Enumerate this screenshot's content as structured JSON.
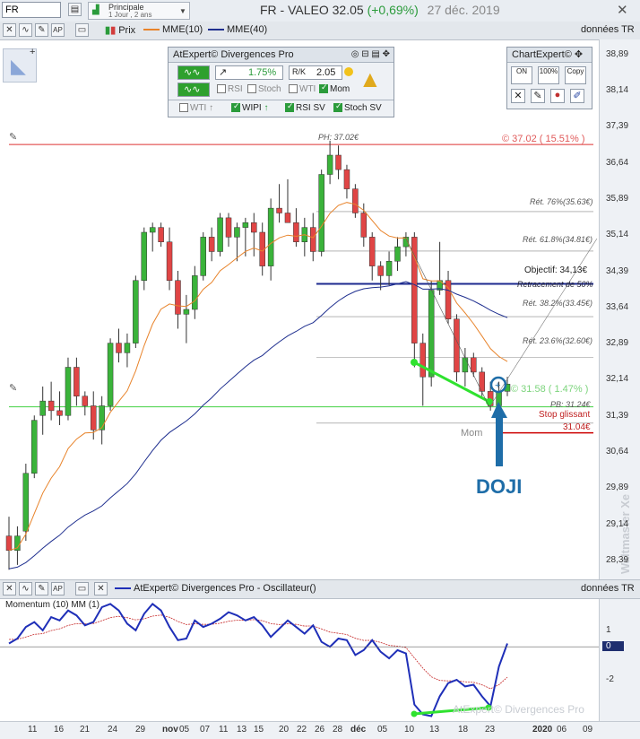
{
  "top": {
    "symbol_value": "FR",
    "period_label": "Principale",
    "period_sub": "1 Jour , 2 ans",
    "title_main": "FR - VALEO  32.05",
    "title_change": "(+0,69%)",
    "title_date": "27 déc. 2019"
  },
  "toolbar": {
    "prix_label": "Prix",
    "mme10_label": "MME(10)",
    "mme40_label": "MME(40)",
    "donnees_label": "données TR"
  },
  "atexpert": {
    "title": "AtExpert© Divergences Pro",
    "pct": "1.75%",
    "value": "2.05",
    "rsi": "RSI",
    "stoch": "Stoch",
    "wti": "WTI",
    "mom": "Mom",
    "wti_up": "WTI",
    "wipi": "WIPI",
    "rsi_sv": "RSI SV",
    "stoch_sv": "Stoch SV"
  },
  "chartexpert": {
    "title": "ChartExpert©",
    "on": "ON",
    "pct100": "100%",
    "copy": "Copy"
  },
  "annotations": {
    "ph": "PH: 37.02€",
    "ph_pct": "© 37.02 ( 15.51% )",
    "ret76": "Rét. 76%(35.63€)",
    "ret618": "Rét. 61.8%(34.81€)",
    "objectif": "Objectif: 34,13€",
    "retracement": "Retracement de 50%",
    "ret382": "Rét. 38.2%(33.45€)",
    "ret236": "Rét. 23.6%(32.60€)",
    "last": "© 31.58 ( 1.47% )",
    "pb": "PB: 31.24€",
    "stop": "Stop glissant",
    "stop_val": "31.04€",
    "mom": "Mom",
    "doji": "DOJI",
    "watermark": "Waltmaster Xe"
  },
  "y_axis": [
    "38,89",
    "38,14",
    "37,39",
    "36,64",
    "35,89",
    "35,14",
    "34,39",
    "33,64",
    "32,89",
    "32,14",
    "31,39",
    "30,64",
    "29,89",
    "29,14",
    "28,39"
  ],
  "oscillator": {
    "bar_title": "AtExpert© Divergences Pro - Oscillateur()",
    "donnees_label": "données TR",
    "label": "Momentum (10) MM (1)",
    "axis": [
      "1",
      "0",
      "-2"
    ],
    "watermark": "AtExpert© Divergences Pro"
  },
  "x_axis": [
    "11",
    "16",
    "21",
    "24",
    "29",
    "nov",
    "05",
    "07",
    "11",
    "13",
    "15",
    "20",
    "22",
    "26",
    "28",
    "déc",
    "05",
    "10",
    "13",
    "18",
    "23",
    "2020",
    "06",
    "09"
  ],
  "chart_data": {
    "type": "candlestick",
    "title": "FR - VALEO",
    "series": [
      {
        "name": "Prix"
      },
      {
        "name": "MME(10)",
        "color": "#e8832a"
      },
      {
        "name": "MME(40)",
        "color": "#1f2f8f"
      }
    ],
    "ylim": [
      28.0,
      39.2
    ],
    "y_ticks": [
      38.89,
      38.14,
      37.39,
      36.64,
      35.89,
      35.14,
      34.39,
      33.64,
      32.89,
      32.14,
      31.39,
      30.64,
      29.89,
      29.14,
      28.39
    ],
    "levels": {
      "ph": 37.02,
      "ret76": 35.63,
      "ret618": 34.81,
      "objectif": 34.13,
      "ret382": 33.45,
      "ret236": 32.6,
      "last": 31.58,
      "pb": 31.24,
      "stop": 31.04
    },
    "ohlc": [
      [
        28.9,
        29.3,
        28.2,
        28.6
      ],
      [
        28.6,
        29.1,
        28.3,
        28.9
      ],
      [
        29.0,
        30.4,
        28.8,
        30.2
      ],
      [
        30.2,
        31.4,
        30.1,
        31.3
      ],
      [
        31.4,
        32.0,
        31.0,
        31.7
      ],
      [
        31.7,
        32.1,
        31.3,
        31.5
      ],
      [
        31.5,
        31.9,
        31.2,
        31.4
      ],
      [
        31.4,
        32.6,
        31.3,
        32.4
      ],
      [
        32.4,
        32.6,
        31.6,
        31.8
      ],
      [
        31.8,
        31.9,
        31.4,
        31.6
      ],
      [
        31.6,
        31.9,
        30.9,
        31.1
      ],
      [
        31.1,
        31.8,
        30.8,
        31.6
      ],
      [
        31.6,
        33.0,
        31.5,
        32.9
      ],
      [
        32.9,
        33.2,
        32.5,
        32.7
      ],
      [
        32.7,
        33.1,
        32.4,
        32.9
      ],
      [
        32.9,
        34.3,
        32.8,
        34.2
      ],
      [
        34.2,
        35.3,
        34.0,
        35.2
      ],
      [
        35.2,
        35.4,
        34.8,
        35.3
      ],
      [
        35.3,
        35.4,
        34.9,
        35.0
      ],
      [
        35.0,
        35.3,
        34.0,
        34.2
      ],
      [
        34.2,
        34.4,
        33.2,
        33.5
      ],
      [
        33.5,
        33.9,
        32.9,
        33.6
      ],
      [
        33.6,
        34.5,
        33.4,
        34.3
      ],
      [
        34.3,
        35.2,
        34.2,
        35.1
      ],
      [
        35.1,
        35.3,
        34.6,
        34.8
      ],
      [
        34.8,
        35.6,
        34.7,
        35.5
      ],
      [
        35.5,
        35.6,
        34.9,
        35.1
      ],
      [
        35.1,
        35.4,
        34.6,
        35.3
      ],
      [
        35.3,
        35.5,
        34.7,
        35.4
      ],
      [
        35.4,
        35.6,
        34.7,
        35.2
      ],
      [
        35.2,
        35.4,
        34.3,
        34.5
      ],
      [
        34.5,
        35.9,
        34.2,
        35.7
      ],
      [
        35.7,
        36.2,
        35.4,
        35.6
      ],
      [
        35.6,
        36.3,
        35.4,
        35.4
      ],
      [
        35.4,
        35.7,
        34.9,
        35.0
      ],
      [
        35.0,
        35.5,
        34.7,
        35.3
      ],
      [
        35.3,
        35.6,
        34.6,
        34.8
      ],
      [
        34.8,
        36.5,
        34.7,
        36.4
      ],
      [
        36.4,
        37.1,
        36.2,
        36.8
      ],
      [
        36.8,
        37.0,
        36.3,
        36.5
      ],
      [
        36.5,
        36.6,
        35.9,
        36.1
      ],
      [
        36.1,
        36.2,
        35.5,
        35.6
      ],
      [
        35.6,
        35.8,
        34.9,
        35.1
      ],
      [
        35.1,
        35.2,
        34.2,
        34.5
      ],
      [
        34.5,
        34.6,
        34.0,
        34.3
      ],
      [
        34.3,
        34.8,
        34.1,
        34.6
      ],
      [
        34.6,
        35.1,
        34.4,
        34.9
      ],
      [
        34.9,
        35.2,
        34.7,
        35.1
      ],
      [
        35.1,
        35.2,
        32.4,
        32.9
      ],
      [
        32.9,
        33.1,
        31.6,
        32.2
      ],
      [
        32.2,
        34.2,
        32.0,
        34.0
      ],
      [
        34.0,
        35.0,
        33.9,
        34.2
      ],
      [
        34.2,
        34.4,
        33.3,
        33.4
      ],
      [
        33.4,
        33.5,
        32.1,
        32.3
      ],
      [
        32.3,
        32.8,
        32.0,
        32.6
      ],
      [
        32.6,
        32.7,
        32.2,
        32.3
      ],
      [
        32.3,
        32.4,
        31.8,
        31.9
      ],
      [
        31.9,
        32.1,
        31.5,
        31.6
      ],
      [
        31.6,
        32.1,
        31.5,
        31.9
      ],
      [
        31.9,
        32.2,
        31.8,
        32.05
      ]
    ],
    "oscillator": {
      "name": "Momentum (10) MM (1)",
      "ylim": [
        -4.5,
        3.0
      ],
      "values": [
        0.2,
        0.5,
        1.2,
        1.5,
        1.0,
        1.8,
        1.6,
        2.2,
        1.9,
        1.3,
        1.5,
        2.4,
        2.6,
        2.2,
        1.4,
        1.0,
        2.0,
        2.6,
        2.2,
        1.2,
        0.4,
        0.5,
        1.6,
        1.2,
        1.4,
        1.7,
        2.1,
        1.9,
        1.6,
        1.8,
        1.3,
        0.6,
        1.1,
        1.6,
        1.2,
        0.8,
        1.3,
        0.3,
        0.0,
        0.5,
        0.4,
        -0.5,
        -0.2,
        0.4,
        -0.3,
        -0.7,
        -0.2,
        -0.4,
        -3.5,
        -4.1,
        -4.2,
        -3.0,
        -2.2,
        -2.0,
        -2.4,
        -2.3,
        -3.0,
        -3.6,
        -1.2,
        0.2
      ]
    }
  }
}
